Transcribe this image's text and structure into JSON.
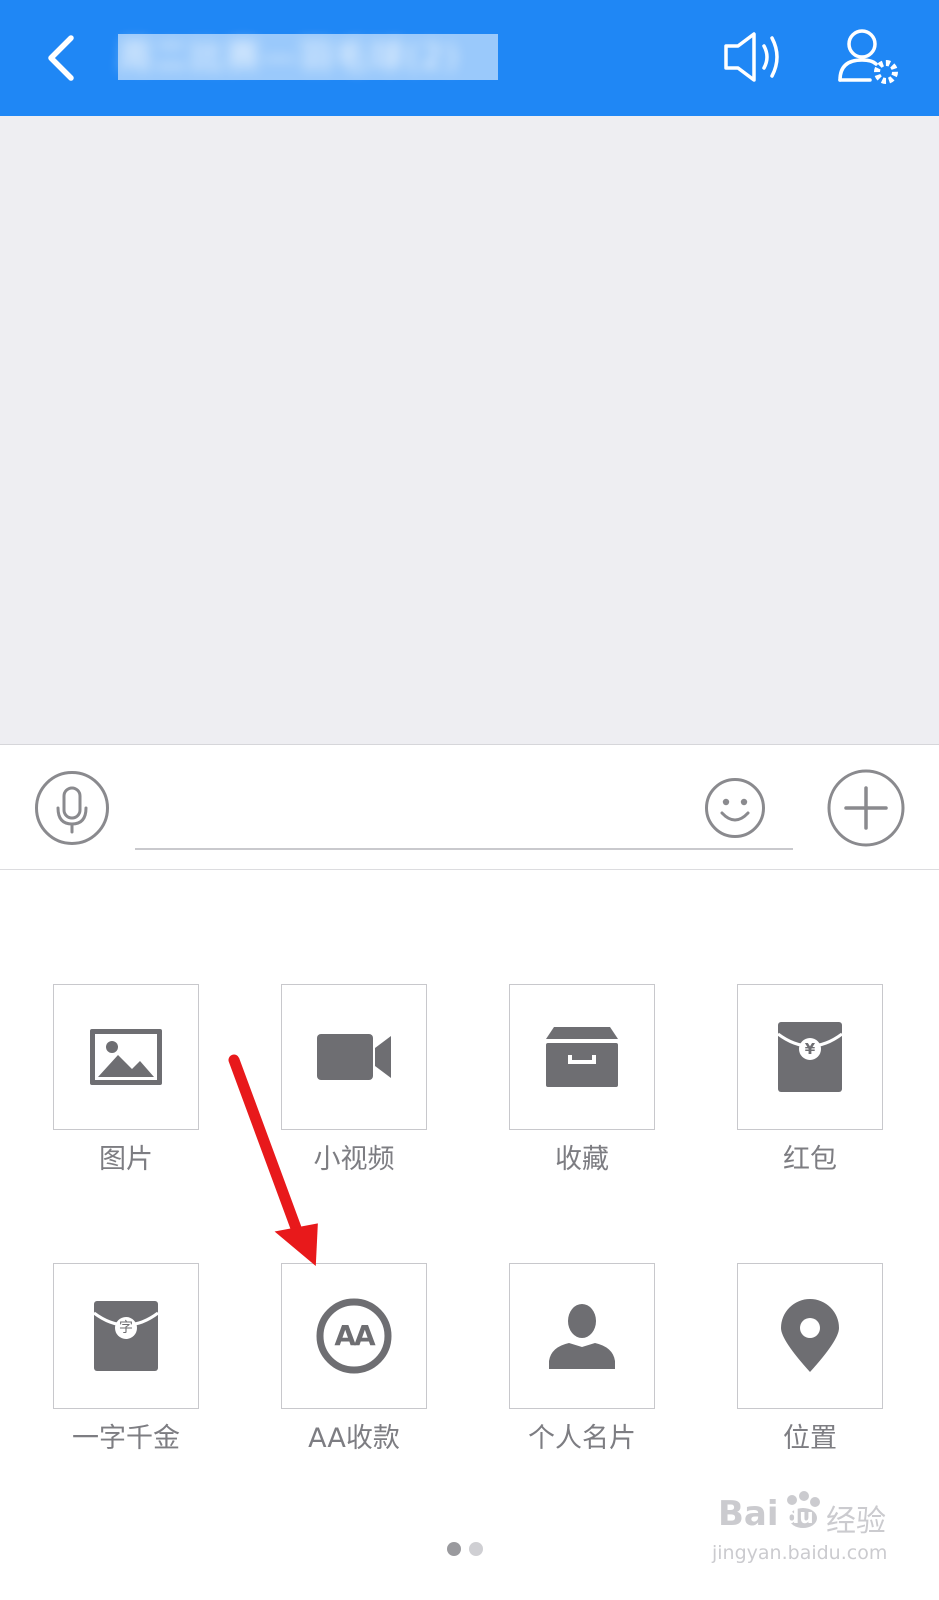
{
  "header": {
    "title": "周二比赛—羽毛球(2)",
    "back_icon": "back-chevron-icon",
    "speaker_icon": "speaker-icon",
    "settings_icon": "group-settings-icon",
    "accent_color": "#1f87f5"
  },
  "input_bar": {
    "voice_icon": "microphone-icon",
    "emoji_icon": "smiley-icon",
    "plus_icon": "plus-icon",
    "text_value": ""
  },
  "panel": {
    "items": [
      {
        "label": "图片",
        "icon": "image-icon"
      },
      {
        "label": "小视频",
        "icon": "video-camera-icon"
      },
      {
        "label": "收藏",
        "icon": "archive-box-icon"
      },
      {
        "label": "红包",
        "icon": "red-envelope-icon"
      },
      {
        "label": "一字千金",
        "icon": "word-envelope-icon"
      },
      {
        "label": "AA收款",
        "icon": "aa-payment-icon"
      },
      {
        "label": "个人名片",
        "icon": "person-icon"
      },
      {
        "label": "位置",
        "icon": "location-pin-icon"
      }
    ],
    "page_count": 2,
    "current_page": 1,
    "envelope_glyph": "¥",
    "word_glyph": "字",
    "aa_glyph": "AA"
  },
  "annotation": {
    "arrow_color": "#e8191b"
  },
  "watermark": {
    "brand": "Bai",
    "paw": "du",
    "product": "经验",
    "url": "jingyan.baidu.com"
  }
}
